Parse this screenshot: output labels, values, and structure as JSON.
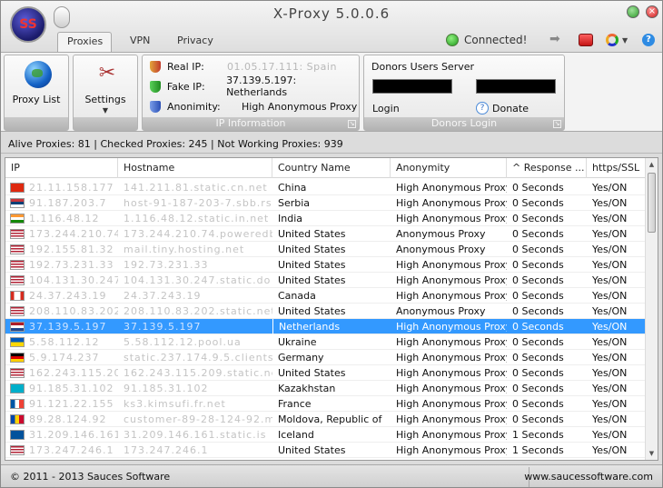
{
  "window": {
    "title": "X-Proxy 5.0.0.6",
    "logo_text": "SS"
  },
  "tabs": [
    {
      "label": "Proxies",
      "active": true
    },
    {
      "label": "VPN",
      "active": false
    },
    {
      "label": "Privacy",
      "active": false
    }
  ],
  "status": {
    "text": "Connected!",
    "color": "#2aa52a"
  },
  "icons": {
    "forward": "arrow-right-icon",
    "stop": "stop-icon",
    "theme": "color-ring-icon",
    "help": "help-icon",
    "proxy_list": "globe-icon",
    "settings": "tools-icon"
  },
  "ribbon": {
    "proxy_list_label": "Proxy List",
    "settings_label": "Settings",
    "ip_info": {
      "footer": "IP Information",
      "real_ip_label": "Real IP:",
      "real_ip_value": "01.05.17.111: Spain",
      "fake_ip_label": "Fake IP:",
      "fake_ip_value": "37.139.5.197: Netherlands",
      "anonimity_label": "Anonimity:",
      "anonimity_value": "High Anonymous Proxy"
    },
    "donors": {
      "title": "Donors Users Server",
      "footer": "Donors Login",
      "login_label": "Login",
      "donate_label": "Donate"
    }
  },
  "summary": "Alive Proxies: 81 | Checked Proxies: 245 | Not Working Proxies: 939",
  "table": {
    "columns": [
      "IP",
      "Hostname",
      "Country Name",
      "Anonymity",
      "^ Response ...",
      "https/SSL"
    ],
    "rows": [
      {
        "ip": "21.11.158.177",
        "host": "141.211.81.static.cn.net",
        "country": "China",
        "anonymity": "High Anonymous Proxy",
        "response": "0 Seconds",
        "ssl": "Yes/ON",
        "flag": "china"
      },
      {
        "ip": "91.187.203.7",
        "host": "host-91-187-203-7.sbb.rs",
        "country": "Serbia",
        "anonymity": "High Anonymous Proxy",
        "response": "0 Seconds",
        "ssl": "Yes/ON",
        "flag": "serbia"
      },
      {
        "ip": "1.116.48.12",
        "host": "1.116.48.12.static.in.net",
        "country": "India",
        "anonymity": "High Anonymous Proxy",
        "response": "0 Seconds",
        "ssl": "Yes/ON",
        "flag": "india"
      },
      {
        "ip": "173.244.210.74",
        "host": "173.244.210.74.poweredby",
        "country": "United States",
        "anonymity": "Anonymous Proxy",
        "response": "0 Seconds",
        "ssl": "Yes/ON",
        "flag": "us"
      },
      {
        "ip": "192.155.81.32",
        "host": "mail.tiny.hosting.net",
        "country": "United States",
        "anonymity": "Anonymous Proxy",
        "response": "0 Seconds",
        "ssl": "Yes/ON",
        "flag": "us"
      },
      {
        "ip": "192.73.231.33",
        "host": "192.73.231.33",
        "country": "United States",
        "anonymity": "High Anonymous Proxy",
        "response": "0 Seconds",
        "ssl": "Yes/ON",
        "flag": "us"
      },
      {
        "ip": "104.131.30.247",
        "host": "104.131.30.247.static.do",
        "country": "United States",
        "anonymity": "High Anonymous Proxy",
        "response": "0 Seconds",
        "ssl": "Yes/ON",
        "flag": "us"
      },
      {
        "ip": "24.37.243.19",
        "host": "24.37.243.19",
        "country": "Canada",
        "anonymity": "High Anonymous Proxy",
        "response": "0 Seconds",
        "ssl": "Yes/ON",
        "flag": "canada"
      },
      {
        "ip": "208.110.83.202",
        "host": "208.110.83.202.static.net",
        "country": "United States",
        "anonymity": "Anonymous Proxy",
        "response": "0 Seconds",
        "ssl": "Yes/ON",
        "flag": "us"
      },
      {
        "ip": "37.139.5.197",
        "host": "37.139.5.197",
        "country": "Netherlands",
        "anonymity": "High Anonymous Proxy",
        "response": "0 Seconds",
        "ssl": "Yes/ON",
        "flag": "netherlands",
        "selected": true
      },
      {
        "ip": "5.58.112.12",
        "host": "5.58.112.12.pool.ua",
        "country": "Ukraine",
        "anonymity": "High Anonymous Proxy",
        "response": "0 Seconds",
        "ssl": "Yes/ON",
        "flag": "ukraine"
      },
      {
        "ip": "5.9.174.237",
        "host": "static.237.174.9.5.clients.net",
        "country": "Germany",
        "anonymity": "High Anonymous Proxy",
        "response": "0 Seconds",
        "ssl": "Yes/ON",
        "flag": "germany"
      },
      {
        "ip": "162.243.115.209",
        "host": "162.243.115.209.static.net",
        "country": "United States",
        "anonymity": "High Anonymous Proxy",
        "response": "0 Seconds",
        "ssl": "Yes/ON",
        "flag": "us"
      },
      {
        "ip": "91.185.31.102",
        "host": "91.185.31.102",
        "country": "Kazakhstan",
        "anonymity": "High Anonymous Proxy",
        "response": "0 Seconds",
        "ssl": "Yes/ON",
        "flag": "kazakhstan"
      },
      {
        "ip": "91.121.22.155",
        "host": "ks3.kimsufi.fr.net",
        "country": "France",
        "anonymity": "High Anonymous Proxy",
        "response": "0 Seconds",
        "ssl": "Yes/ON",
        "flag": "france"
      },
      {
        "ip": "89.28.124.92",
        "host": "customer-89-28-124-92.md",
        "country": "Moldova, Republic of",
        "anonymity": "High Anonymous Proxy",
        "response": "0 Seconds",
        "ssl": "Yes/ON",
        "flag": "moldova"
      },
      {
        "ip": "31.209.146.161",
        "host": "31.209.146.161.static.is",
        "country": "Iceland",
        "anonymity": "High Anonymous Proxy",
        "response": "1 Seconds",
        "ssl": "Yes/ON",
        "flag": "iceland"
      },
      {
        "ip": "173.247.246.1",
        "host": "173.247.246.1",
        "country": "United States",
        "anonymity": "High Anonymous Proxy",
        "response": "1 Seconds",
        "ssl": "Yes/ON",
        "flag": "us"
      }
    ]
  },
  "footer": {
    "copyright": "© 2011 - 2013 Sauces Software",
    "website": "www.saucessoftware.com"
  }
}
